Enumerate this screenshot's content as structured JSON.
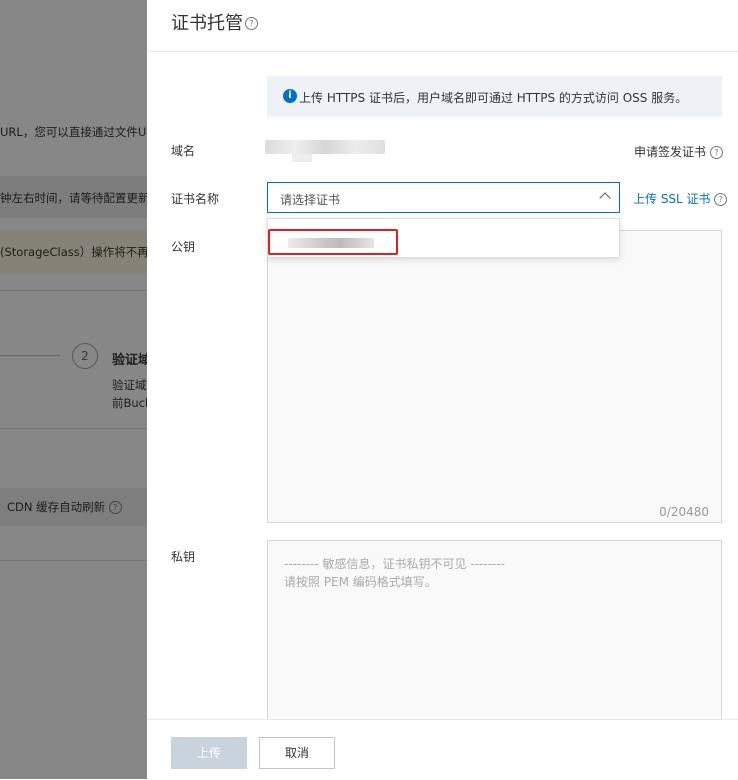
{
  "background": {
    "url_text": "URL，您可以直接通过文件U",
    "warn_text": "钟左右时间，请等待配置更新",
    "storage_text": "(StorageClass）操作将不再支",
    "step_number": "2",
    "step_title": "验证域",
    "step_desc1": "验证域",
    "step_desc2": "前Buck",
    "cdn_text": "CDN 缓存自动刷新"
  },
  "panel": {
    "title": "证书托管",
    "info_text": "上传 HTTPS 证书后，用户域名即可通过 HTTPS 的方式访问 OSS 服务。",
    "domain_label": "域名",
    "apply_link": "申请签发证书",
    "cert_name_label": "证书名称",
    "select_placeholder": "请选择证书",
    "upload_ssl_link": "上传 SSL 证书",
    "public_key_label": "公钥",
    "public_key_counter": "0/20480",
    "private_key_label": "私钥",
    "private_key_placeholder_1": "-------- 敏感信息，证书私钥不可见 --------",
    "private_key_placeholder_2": "请按照 PEM 编码格式填写。"
  },
  "footer": {
    "upload_label": "上传",
    "cancel_label": "取消"
  },
  "colors": {
    "accent": "#0070cc",
    "highlight": "#e02020",
    "disabled_button": "#c9d3dd"
  }
}
